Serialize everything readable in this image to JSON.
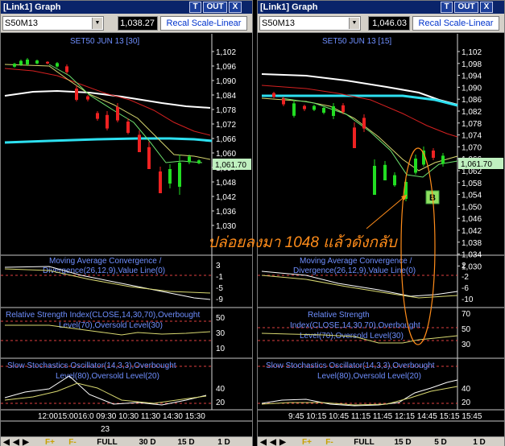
{
  "left": {
    "title": "[Link1] Graph",
    "buttons": {
      "t": "T",
      "out": "OUT",
      "close": "X"
    },
    "symbol": "S50M13",
    "price": "1,038.27",
    "recal": "Recal Scale-Linear",
    "chart_title": "SET50 JUN 13   [30]",
    "last_price": "1,061.70",
    "price_ticks": [
      "1,102",
      "1,096",
      "1,090",
      "1,084",
      "1,078",
      "1,072",
      "1,066",
      "1,060",
      "1,054",
      "1,048",
      "1,042",
      "1,036",
      "1,030"
    ],
    "macd_label": [
      "Moving Average Convergence /",
      "Divergence(26,12,9),Value Line(0)"
    ],
    "macd_ticks": [
      "3",
      "-1",
      "-5",
      "-9"
    ],
    "rsi_label": [
      "Relative Strength Index(CLOSE,14,30,70),Overbought",
      "Level(70),Oversold Level(30)"
    ],
    "rsi_ticks": [
      "50",
      "30",
      "10"
    ],
    "sto_label": [
      "Slow Stochastics Oscillator(14,3,3),Overbought",
      "Level(80),Oversold Level(20)"
    ],
    "sto_ticks": [
      "40",
      "20"
    ],
    "time_ticks": "12:0015:0016:0 09:30 10:30 11:30 14:30 15:30",
    "date_tick": "23",
    "footer": [
      "F+",
      "F-",
      "FULL",
      "30 D",
      "15 D",
      "1 D"
    ]
  },
  "right": {
    "title": "[Link1] Graph",
    "buttons": {
      "t": "T",
      "out": "OUT",
      "close": "X"
    },
    "symbol": "S50M13",
    "price": "1,046.03",
    "recal": "Recal Scale-Linear",
    "chart_title": "SET50 JUN 13   [15]",
    "last_price": "1,061.70",
    "marker": "B",
    "price_ticks": [
      "1,102",
      "1,098",
      "1,094",
      "1,090",
      "1,086",
      "1,082",
      "1,078",
      "1,074",
      "1,070",
      "1,066",
      "1,062",
      "1,058",
      "1,054",
      "1,050",
      "1,046",
      "1,042",
      "1,038",
      "1,034",
      "1,030"
    ],
    "macd_label": [
      "Moving Average Convergence /",
      "Divergence(26,12,9),Value Line(0)"
    ],
    "macd_ticks": [
      "2",
      "-2",
      "-6",
      "-10"
    ],
    "rsi_label": [
      "Relative Strength",
      "Index(CLOSE,14,30,70),Overbought",
      "Level(70),Oversold Level(30)"
    ],
    "rsi_ticks": [
      "70",
      "50",
      "30"
    ],
    "sto_label": [
      "Slow Stochastics Oscillator(14,3,3),Overbought",
      "Level(80),Oversold Level(20)"
    ],
    "sto_ticks": [
      "40",
      "20"
    ],
    "time_ticks": "9:45 10:15 10:45 11:15 11:45 12:15 14:45 15:15 15:45",
    "footer": [
      "F+",
      "F-",
      "FULL",
      "15 D",
      "5 D",
      "1 D"
    ]
  },
  "annotation": "ปล่อยลงมา 1048 แล้วดังกลับ",
  "colors": {
    "bull": "#22dd22",
    "bear": "#ee2222",
    "cyan": "#2de0f0",
    "white_ma": "#ffffff",
    "red_ma": "#d42020",
    "yellow_ma": "#d8d870",
    "green_ma": "#6fe36f",
    "annotation": "#ff8c1a",
    "title_bar": "#0a246a"
  }
}
